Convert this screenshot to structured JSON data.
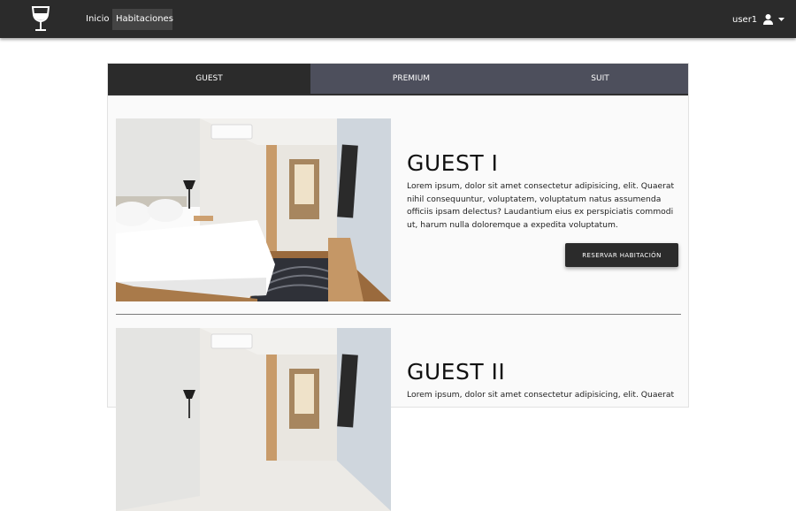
{
  "navbar": {
    "logo_icon": "wine-glass-icon",
    "links": [
      {
        "label": "Inicio",
        "active": false
      },
      {
        "label": "Habitaciones",
        "active": true
      }
    ],
    "user": {
      "name": "user1",
      "icon": "user-icon",
      "dropdown_icon": "caret-down-icon"
    }
  },
  "tabs": [
    {
      "label": "GUEST",
      "active": true
    },
    {
      "label": "PREMIUM",
      "active": false
    },
    {
      "label": "SUIT",
      "active": false
    }
  ],
  "rooms": [
    {
      "title": "GUEST I",
      "description": "Lorem ipsum, dolor sit amet consectetur adipisicing, elit. Quaerat nihil consequuntur, voluptatem, voluptatum natus assumenda officiis ipsam delectus? Laudantium eius ex perspiciatis commodi ut, harum nulla doloremque a expedita voluptatum.",
      "button_label": "RESERVAR HABITACIÓN",
      "image": "hotel-room-photo"
    },
    {
      "title": "GUEST II",
      "description": "Lorem ipsum, dolor sit amet consectetur adipisicing, elit. Quaerat",
      "image": "hotel-room-photo"
    }
  ],
  "colors": {
    "navbar": "#2b2b2b",
    "tab_active": "#2b2b2b",
    "tab_inactive": "#4d4f5c",
    "button": "#2b2b2b"
  }
}
